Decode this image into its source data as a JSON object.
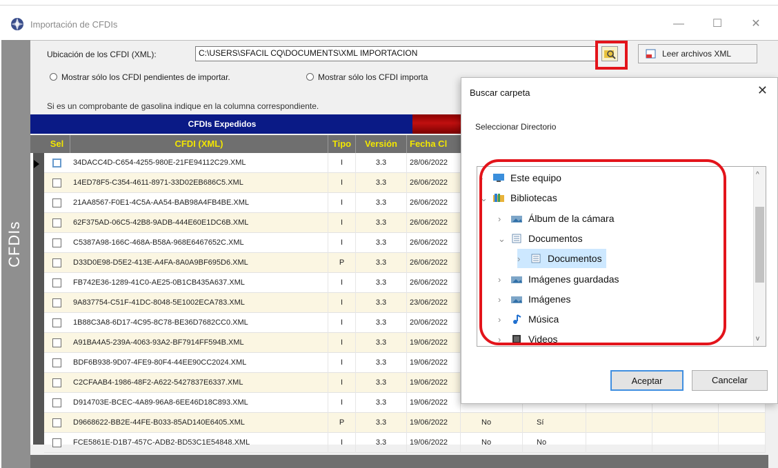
{
  "window": {
    "title": "Importación de CFDIs",
    "minimize": "—",
    "maximize": "☐",
    "close": "✕"
  },
  "side_tab": {
    "label": "CFDIs"
  },
  "toolbar": {
    "ubicacion_label": "Ubicación de los CFDI (XML):",
    "path_value": "C:\\USERS\\SFACIL CQ\\DOCUMENTS\\XML IMPORTACION",
    "leer_label": "Leer archivos XML"
  },
  "filters": {
    "pendientes": "Mostrar sólo los CFDI pendientes de importar.",
    "importados": "Mostrar sólo los CFDI importa"
  },
  "hint": "Si es un comprobante de gasolina indique en la columna correspondiente.",
  "grid": {
    "group_header": "CFDIs Expedidos",
    "columns": {
      "sel": "Sel",
      "cfdi": "CFDI (XML)",
      "tipo": "Tipo",
      "version": "Versión",
      "fecha": "Fecha Cl"
    },
    "rows": [
      {
        "file": "34DACC4D-C654-4255-980E-21FE94112C29.XML",
        "tipo": "I",
        "version": "3.3",
        "fecha": "28/06/2022",
        "c5": "",
        "c6": ""
      },
      {
        "file": "14ED78F5-C354-4611-8971-33D02EB686C5.XML",
        "tipo": "I",
        "version": "3.3",
        "fecha": "26/06/2022",
        "c5": "",
        "c6": ""
      },
      {
        "file": "21AA8567-F0E1-4C5A-AA54-BAB98A4FB4BE.XML",
        "tipo": "I",
        "version": "3.3",
        "fecha": "26/06/2022",
        "c5": "",
        "c6": ""
      },
      {
        "file": "62F375AD-06C5-42B8-9ADB-444E60E1DC6B.XML",
        "tipo": "I",
        "version": "3.3",
        "fecha": "26/06/2022",
        "c5": "",
        "c6": ""
      },
      {
        "file": "C5387A98-166C-468A-B58A-968E6467652C.XML",
        "tipo": "I",
        "version": "3.3",
        "fecha": "26/06/2022",
        "c5": "",
        "c6": ""
      },
      {
        "file": "D33D0E98-D5E2-413E-A4FA-8A0A9BF695D6.XML",
        "tipo": "P",
        "version": "3.3",
        "fecha": "26/06/2022",
        "c5": "",
        "c6": ""
      },
      {
        "file": "FB742E36-1289-41C0-AE25-0B1CB435A637.XML",
        "tipo": "I",
        "version": "3.3",
        "fecha": "26/06/2022",
        "c5": "",
        "c6": ""
      },
      {
        "file": "9A837754-C51F-41DC-8048-5E1002ECA783.XML",
        "tipo": "I",
        "version": "3.3",
        "fecha": "23/06/2022",
        "c5": "",
        "c6": ""
      },
      {
        "file": "1B88C3A8-6D17-4C95-8C78-BE36D7682CC0.XML",
        "tipo": "I",
        "version": "3.3",
        "fecha": "20/06/2022",
        "c5": "",
        "c6": ""
      },
      {
        "file": "A91BA4A5-239A-4063-93A2-BF7914FF594B.XML",
        "tipo": "I",
        "version": "3.3",
        "fecha": "19/06/2022",
        "c5": "",
        "c6": ""
      },
      {
        "file": "BDF6B938-9D07-4FE9-80F4-44EE90CC2024.XML",
        "tipo": "I",
        "version": "3.3",
        "fecha": "19/06/2022",
        "c5": "",
        "c6": ""
      },
      {
        "file": "C2CFAAB4-1986-48F2-A622-5427837E6337.XML",
        "tipo": "I",
        "version": "3.3",
        "fecha": "19/06/2022",
        "c5": "",
        "c6": ""
      },
      {
        "file": "D914703E-BCEC-4A89-96A8-6EE46D18C893.XML",
        "tipo": "I",
        "version": "3.3",
        "fecha": "19/06/2022",
        "c5": "",
        "c6": ""
      },
      {
        "file": "D9668622-BB2E-44FE-B033-85AD140E6405.XML",
        "tipo": "P",
        "version": "3.3",
        "fecha": "19/06/2022",
        "c5": "No",
        "c6": "Sí"
      },
      {
        "file": "FCE5861E-D1B7-457C-ADB2-BD53C1E54848.XML",
        "tipo": "I",
        "version": "3.3",
        "fecha": "19/06/2022",
        "c5": "No",
        "c6": "No"
      }
    ]
  },
  "dialog": {
    "title": "Buscar carpeta",
    "subtitle": "Seleccionar Directorio",
    "close": "✕",
    "tree": [
      {
        "label": "Este equipo",
        "icon": "monitor-icon"
      },
      {
        "label": "Bibliotecas",
        "icon": "library-folder-icon"
      },
      {
        "label": "Álbum de la cámara",
        "icon": "picture-folder-icon"
      },
      {
        "label": "Documentos",
        "icon": "document-folder-icon"
      },
      {
        "label": "Documentos",
        "icon": "document-folder-icon"
      },
      {
        "label": "Imágenes guardadas",
        "icon": "picture-folder-icon"
      },
      {
        "label": "Imágenes",
        "icon": "picture-folder-icon"
      },
      {
        "label": "Música",
        "icon": "music-icon"
      },
      {
        "label": "Videos",
        "icon": "video-icon"
      }
    ],
    "ok_label": "Aceptar",
    "cancel_label": "Cancelar"
  },
  "colors": {
    "grid_header_blue": "#0a1a86",
    "column_header_text": "#f2e600",
    "highlight_red": "#e3141b",
    "selection_blue": "#cde8ff"
  }
}
